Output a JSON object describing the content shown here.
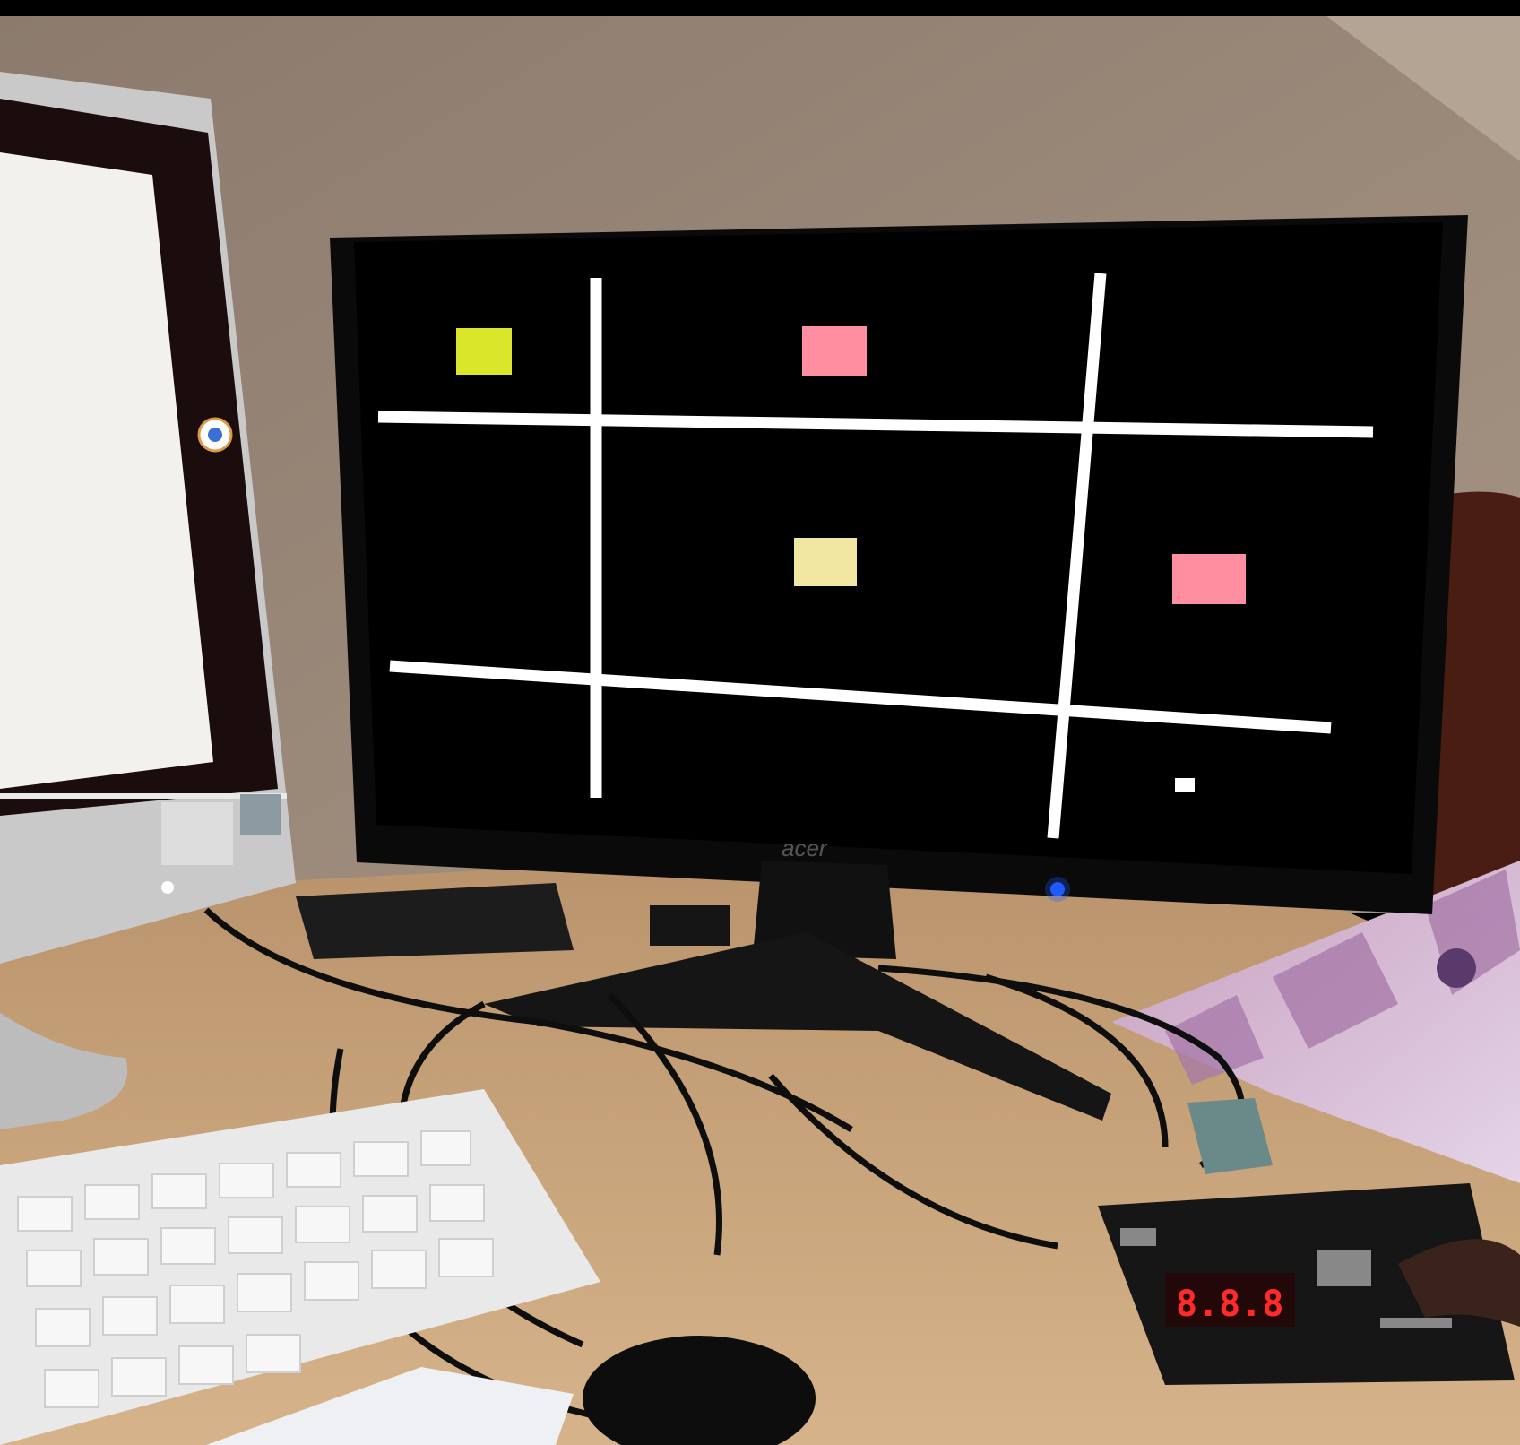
{
  "scene": {
    "description_kind": "photo of desk with FPGA-driven VGA game on monitor",
    "monitor": {
      "brand": "acer",
      "power_led_color": "#1e5bff"
    },
    "game": {
      "grid": {
        "rows": 3,
        "cols": 3,
        "line_color": "#ffffff",
        "background": "#000000"
      },
      "tiles": [
        {
          "row": 0,
          "col": 0,
          "color": "#d9e62a"
        },
        {
          "row": 0,
          "col": 1,
          "color": "#ff8fa0"
        },
        {
          "row": 1,
          "col": 1,
          "color": "#f2e6a3"
        },
        {
          "row": 1,
          "col": 2,
          "color": "#ff8fa0"
        },
        {
          "row": 2,
          "col": 2,
          "color": "#ffffff"
        }
      ]
    },
    "fpga_board": {
      "seven_segment_display": "8.8.8"
    },
    "left_computer": {
      "screen_color": "#f3f1ee",
      "bezel_color": "#1b0d0e"
    }
  }
}
